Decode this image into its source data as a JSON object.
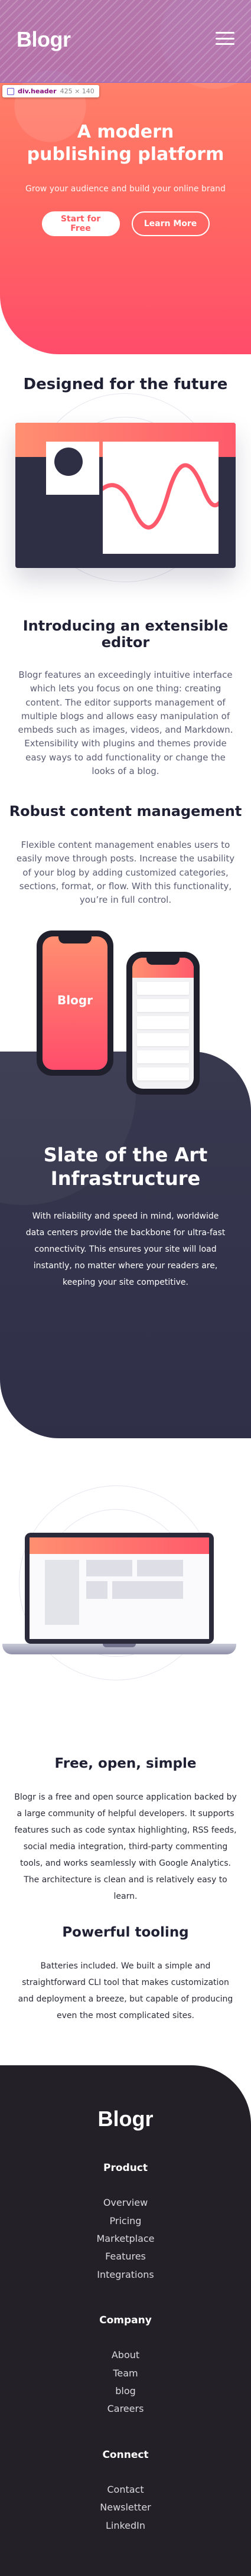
{
  "header": {
    "logo": "Blogr",
    "devtools_tip": {
      "tag": "div.header",
      "dims": "425 × 140"
    }
  },
  "hero": {
    "title": "A modern publishing platform",
    "subtitle": "Grow your audience and build your online brand",
    "buttons": {
      "primary": "Start for Free",
      "secondary": "Learn More"
    }
  },
  "designed": {
    "title": "Designed for the future"
  },
  "extensible": {
    "title": "Introducing an extensible editor",
    "text": "Blogr features an exceedingly intuitive interface which lets you focus on one thing: creating content. The editor supports management of multiple blogs and allows easy manipulation of embeds such as images, videos, and Markdown. Extensibility with plugins and themes provide easy ways to add functionality or change the looks of a blog."
  },
  "robust": {
    "title": "Robust content management",
    "text": "Flexible content management enables users to easily move through posts. Increase the usability of your blog by adding customized categories, sections, format, or flow. With this functionality, you’re in full control."
  },
  "phones": {
    "logo": "Blogr"
  },
  "infra": {
    "title": "Slate of the Art Infrastructure",
    "text": "With reliability and speed in mind, worldwide data centers provide the backbone for ultra-fast connectivity. This ensures your site will load instantly, no matter where your readers are, keeping your site competitive."
  },
  "free": {
    "title": "Free, open, simple",
    "text": "Blogr is a free and open source application backed by a large community of helpful developers. It supports features such as code syntax highlighting, RSS feeds, social media integration, third-party commenting tools, and works seamlessly with Google Analytics. The architecture is clean and is relatively easy to learn."
  },
  "tooling": {
    "title": "Powerful tooling",
    "text": "Batteries included. We built a simple and straightforward CLI tool that makes customization and deployment a breeze, but capable of producing even the most complicated sites."
  },
  "footer": {
    "logo": "Blogr",
    "groups": [
      {
        "heading": "Product",
        "links": [
          "Overview",
          "Pricing",
          "Marketplace",
          "Features",
          "Integrations"
        ]
      },
      {
        "heading": "Company",
        "links": [
          "About",
          "Team",
          "blog",
          "Careers"
        ]
      },
      {
        "heading": "Connect",
        "links": [
          "Contact",
          "Newsletter",
          "LinkedIn"
        ]
      }
    ]
  }
}
